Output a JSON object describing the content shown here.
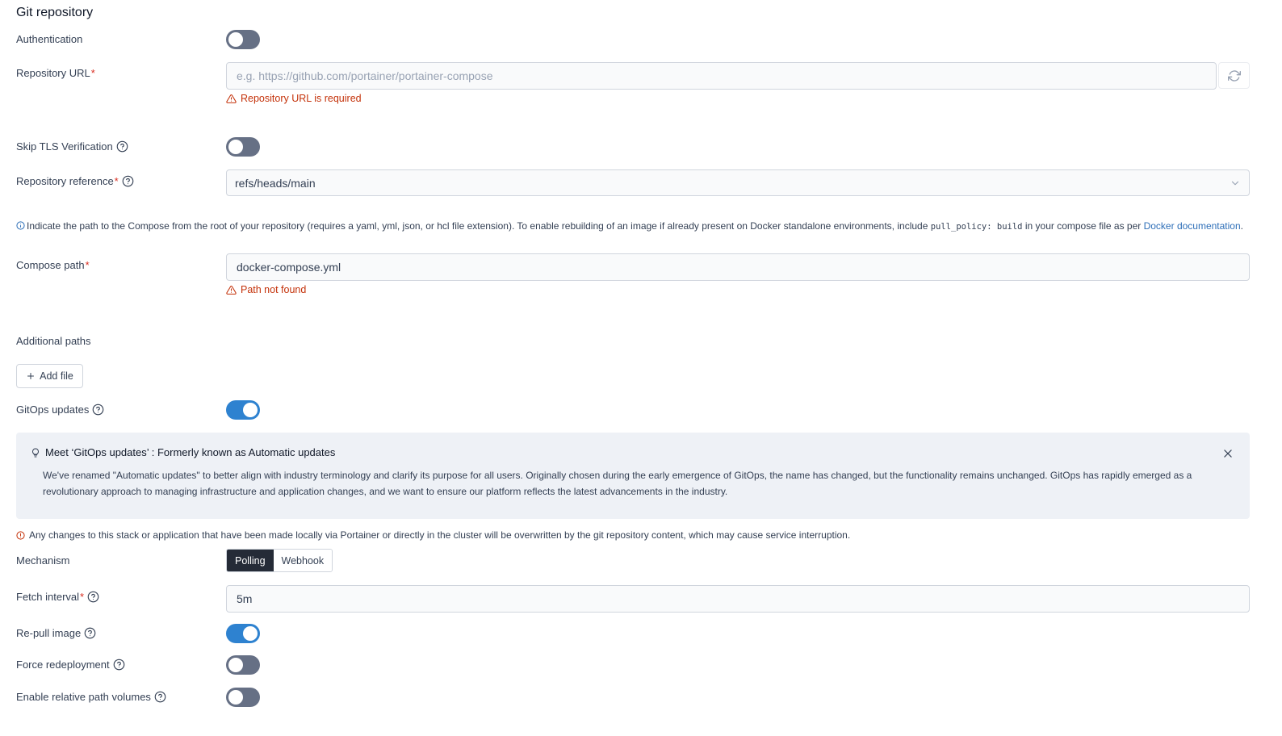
{
  "section_title": "Git repository",
  "authentication": {
    "label": "Authentication",
    "enabled": false
  },
  "repository_url": {
    "label": "Repository URL",
    "required_mark": "*",
    "value": "",
    "placeholder": "e.g. https://github.com/portainer/portainer-compose",
    "error": "Repository URL is required"
  },
  "skip_tls": {
    "label": "Skip TLS Verification",
    "enabled": false
  },
  "repository_reference": {
    "label": "Repository reference",
    "required_mark": "*",
    "value": "refs/heads/main"
  },
  "compose_info": {
    "text_before": "Indicate the path to the Compose from the root of your repository (requires a yaml, yml, json, or hcl file extension).  To enable rebuilding of an image if already present on Docker standalone environments, include ",
    "code": "pull_policy: build",
    "text_middle": " in your compose file as per ",
    "link": "Docker documentation",
    "text_after": "."
  },
  "compose_path": {
    "label": "Compose path",
    "required_mark": "*",
    "value": "docker-compose.yml",
    "error": "Path not found"
  },
  "additional_paths": {
    "label": "Additional paths",
    "add_button": "Add file"
  },
  "gitops_updates": {
    "label": "GitOps updates",
    "enabled": true
  },
  "banner": {
    "title": "Meet ‘GitOps updates’ : Formerly known as Automatic updates",
    "body": "We've renamed \"Automatic updates\" to better align with industry terminology and clarify its purpose for all users. Originally chosen during the early emergence of GitOps, the name has changed, but the functionality remains unchanged. GitOps has rapidly emerged as a revolutionary approach to managing infrastructure and application changes, and we want to ensure our platform reflects the latest advancements in the industry."
  },
  "warning": "Any changes to this stack or application that have been made locally via Portainer or directly in the cluster will be overwritten by the git repository content, which may cause service interruption.",
  "mechanism": {
    "label": "Mechanism",
    "options": [
      "Polling",
      "Webhook"
    ],
    "selected": "Polling"
  },
  "fetch_interval": {
    "label": "Fetch interval",
    "required_mark": "*",
    "value": "5m"
  },
  "repull_image": {
    "label": "Re-pull image",
    "enabled": true
  },
  "force_redeployment": {
    "label": "Force redeployment",
    "enabled": false
  },
  "relative_path_volumes": {
    "label": "Enable relative path volumes",
    "enabled": false
  },
  "colors": {
    "accent": "#2e82d0",
    "error": "#c4320a",
    "required": "#d92d20",
    "toggle_off": "#667085",
    "banner_bg": "#eef1f6"
  }
}
